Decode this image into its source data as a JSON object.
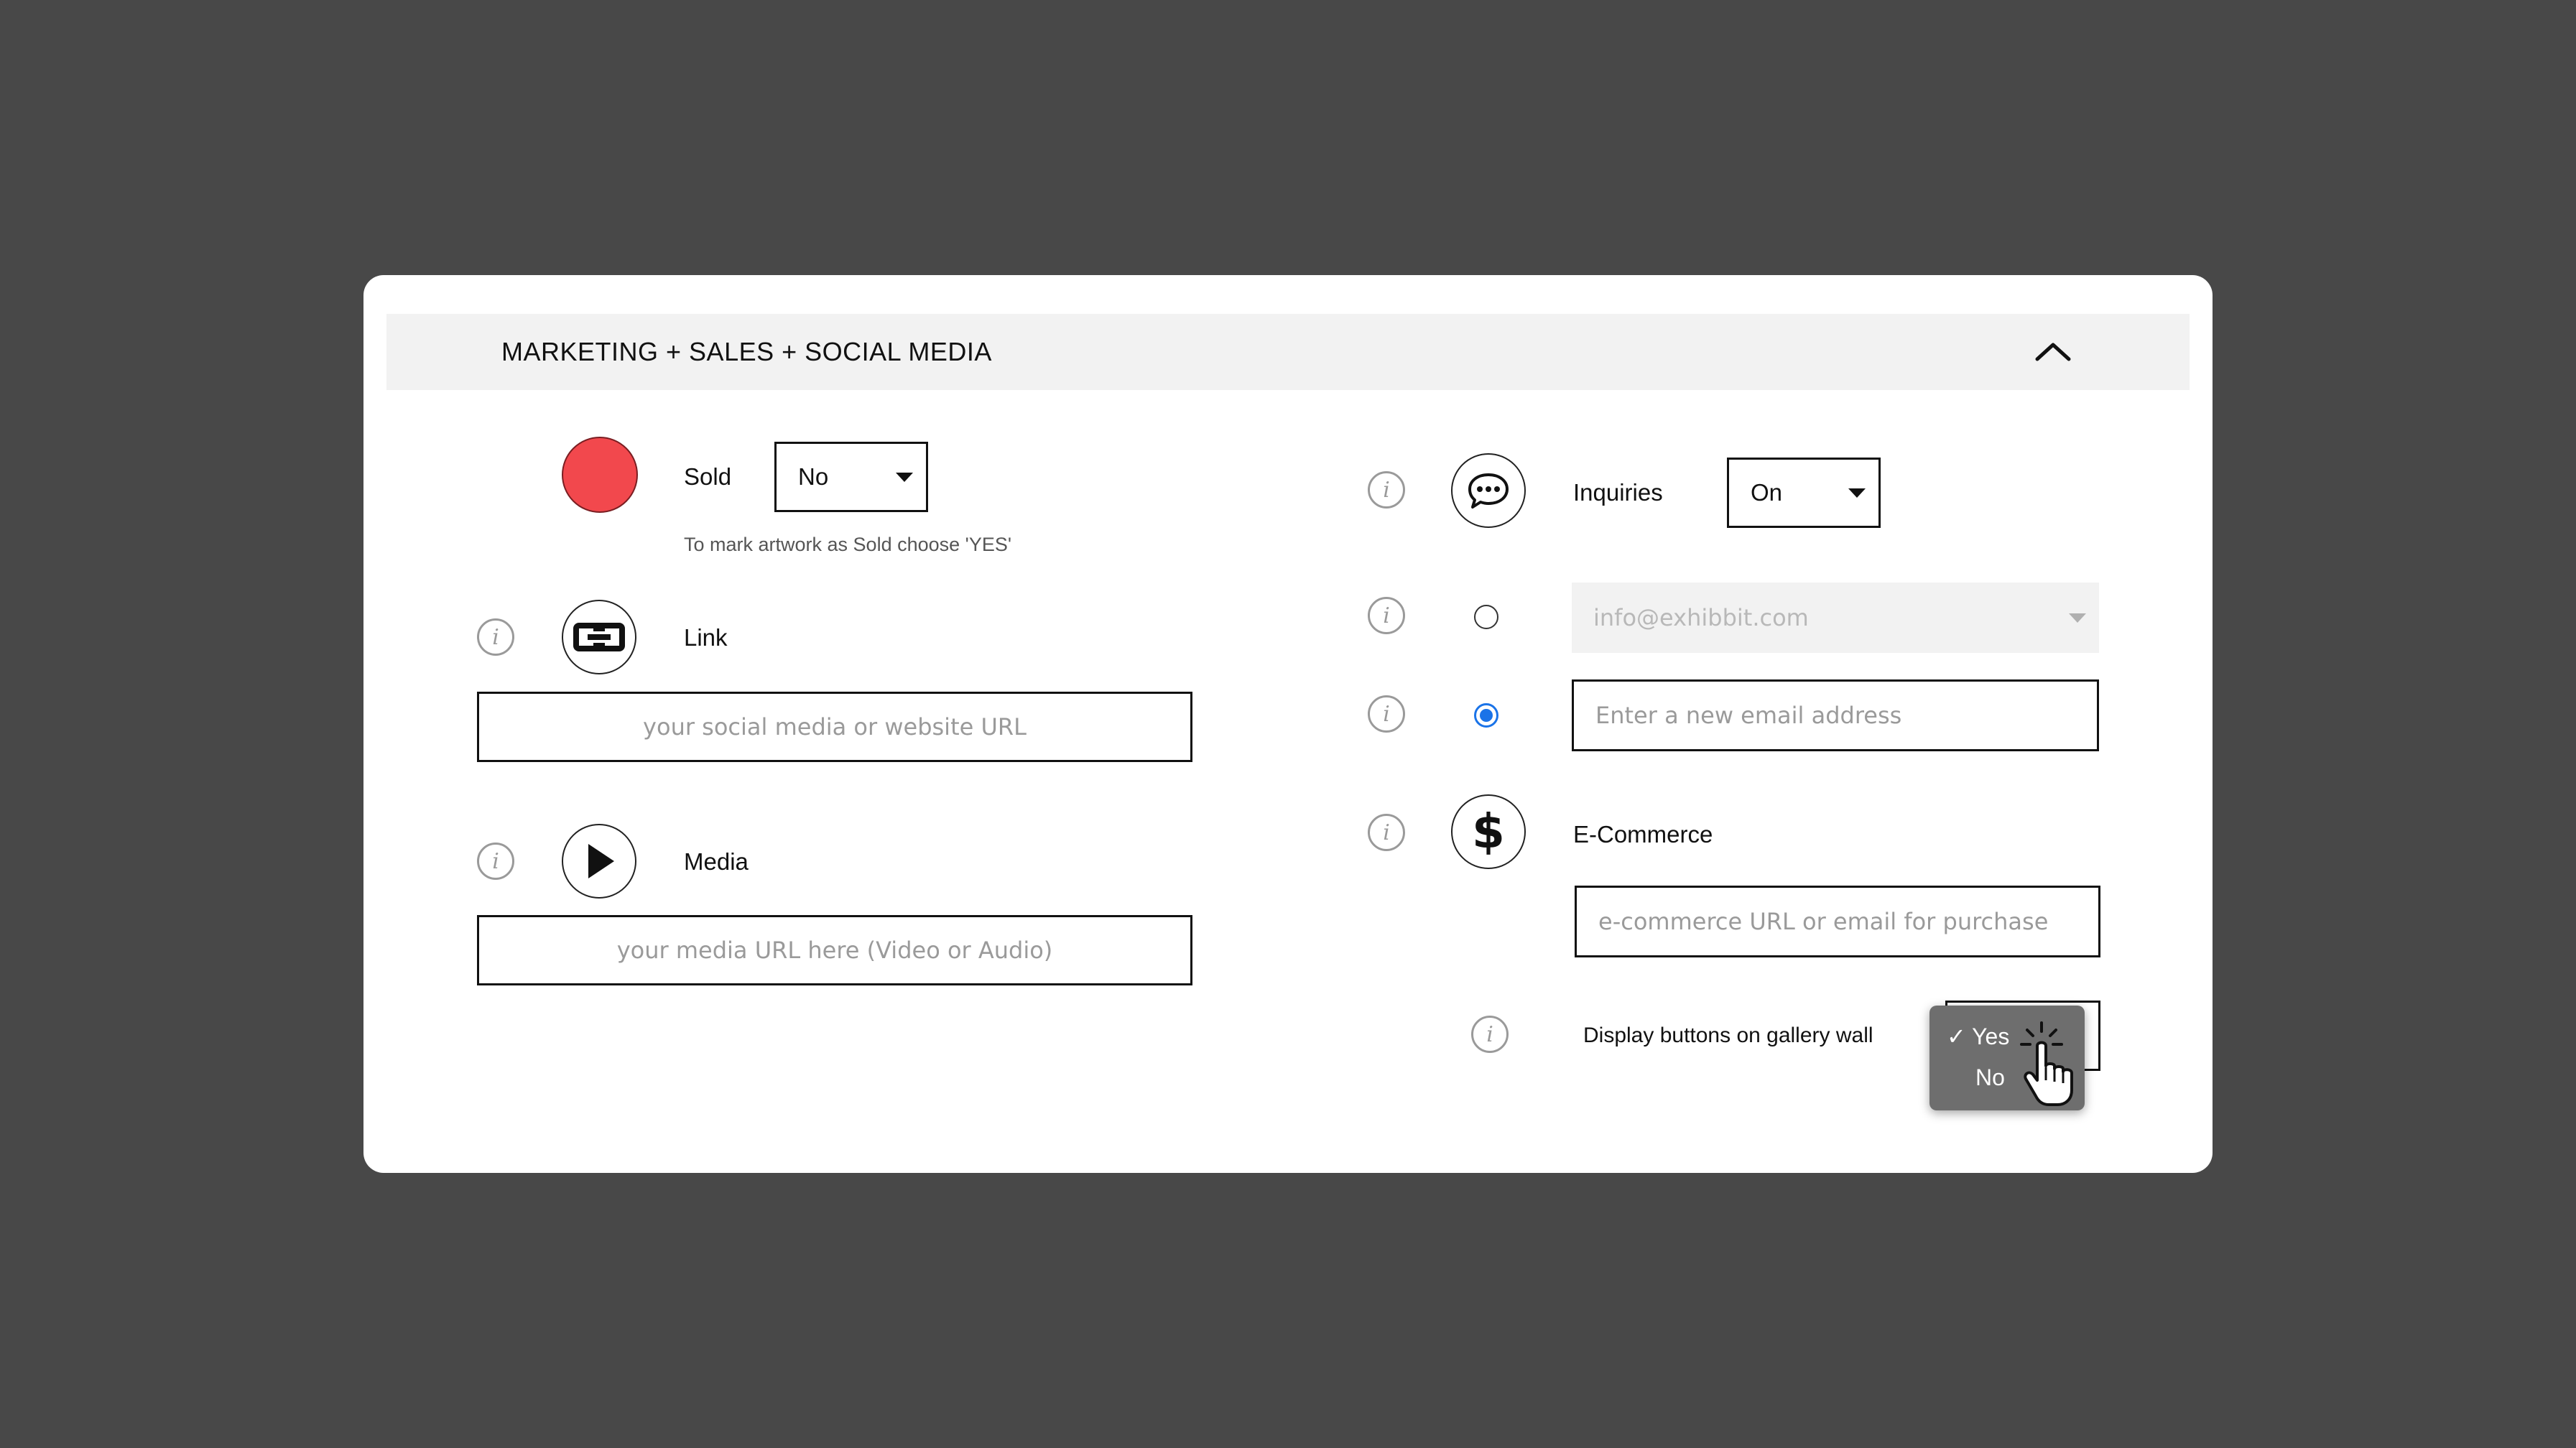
{
  "section": {
    "title": "MARKETING + SALES + SOCIAL MEDIA",
    "collapse_icon": "chevron-up-icon"
  },
  "sold": {
    "label": "Sold",
    "value": "No",
    "hint": "To mark artwork as Sold choose 'YES'",
    "indicator_color": "#f2484d"
  },
  "link": {
    "label": "Link",
    "icon": "link-icon",
    "placeholder": "your social media or website URL",
    "value": ""
  },
  "media": {
    "label": "Media",
    "icon": "play-icon",
    "placeholder": "your media URL here (Video or Audio)",
    "value": ""
  },
  "inquiries": {
    "label": "Inquiries",
    "icon": "chat-bubble-icon",
    "value": "On",
    "existing_email": "info@exhibbit.com",
    "existing_selected": false,
    "new_email_placeholder": "Enter a new email address",
    "new_email_selected": true
  },
  "ecommerce": {
    "label": "E-Commerce",
    "icon": "dollar-icon",
    "placeholder": "e-commerce URL or email for purchase",
    "value": ""
  },
  "gallery_wall": {
    "label": "Display buttons on gallery wall",
    "options": [
      "Yes",
      "No"
    ],
    "selected": "Yes",
    "check_mark": "✓"
  },
  "info_glyph": "i",
  "colors": {
    "background": "#484848",
    "card": "#ffffff",
    "header_bar": "#f2f2f2",
    "radio_accent": "#1a73e8",
    "dropdown_menu": "#6e6e6e"
  }
}
